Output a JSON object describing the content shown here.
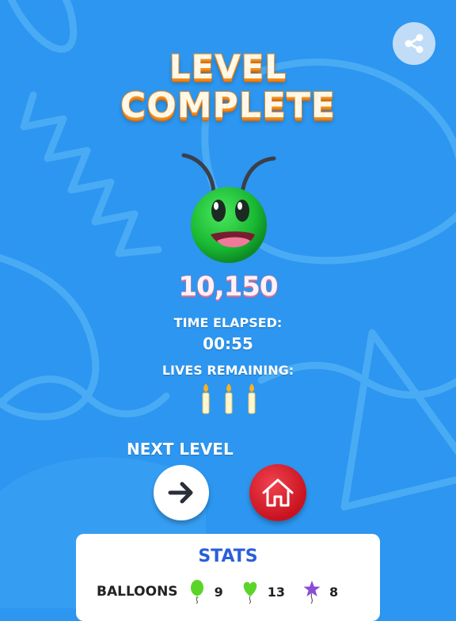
{
  "title_line1": "LEVEL",
  "title_line2": "COMPLETE",
  "score": "10,150",
  "time_label": "TIME ELAPSED:",
  "time_value": "00:55",
  "lives_label": "LIVES REMAINING:",
  "lives_count": 3,
  "next_level_label": "NEXT LEVEL",
  "stats": {
    "title": "STATS",
    "row_label": "BALLOONS",
    "items": [
      {
        "icon": "green-balloon-icon",
        "value": "9"
      },
      {
        "icon": "green-heart-balloon-icon",
        "value": "13"
      },
      {
        "icon": "purple-star-balloon-icon",
        "value": "8"
      }
    ]
  },
  "colors": {
    "background": "#2c96f0",
    "title_fill": "#fff8e8",
    "title_outline": "#f08c1c",
    "home_button": "#d9202d",
    "stats_title": "#2a5fd8",
    "alien": "#2bd142"
  }
}
